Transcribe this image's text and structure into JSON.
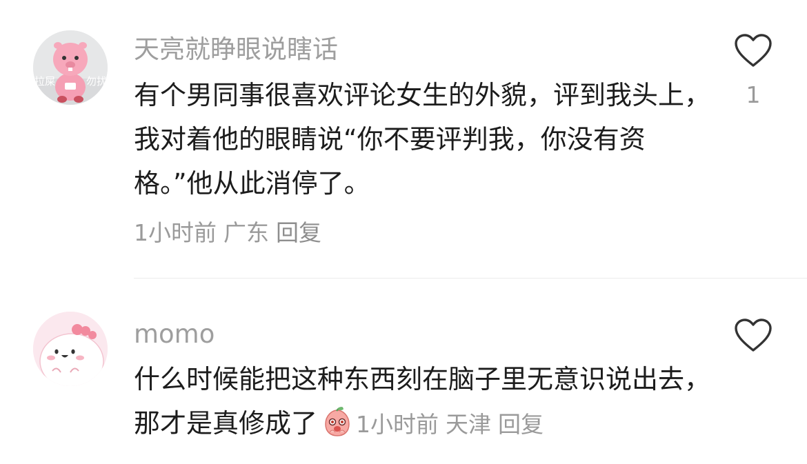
{
  "comments": [
    {
      "username": "天亮就睁眼说瞎话",
      "text": "有个男同事很喜欢评论女生的外貌，评到我头上，我对着他的眼睛说“你不要评判我，你没有资格。”他从此消停了。",
      "time": "1小时前",
      "location": "广东",
      "reply_label": "回复",
      "like_count": "1",
      "avatar_text_left": "拉屎",
      "avatar_text_right": "勿扰",
      "avatar_icon": "pink-beaver-avatar",
      "like_icon": "heart-outline-icon"
    },
    {
      "username": "momo",
      "text": "什么时候能把这种东西刻在脑子里无意识说出去，那才是真修成了",
      "time": "1小时前",
      "location": "天津",
      "reply_label": "回复",
      "emoji_icon": "shy-peach-emoji",
      "avatar_icon": "pink-blob-avatar",
      "like_icon": "heart-outline-icon"
    }
  ],
  "colors": {
    "username": "#9e9e9e",
    "meta": "#9a9a9a",
    "text": "#1c1c1c",
    "divider": "#ececec"
  }
}
